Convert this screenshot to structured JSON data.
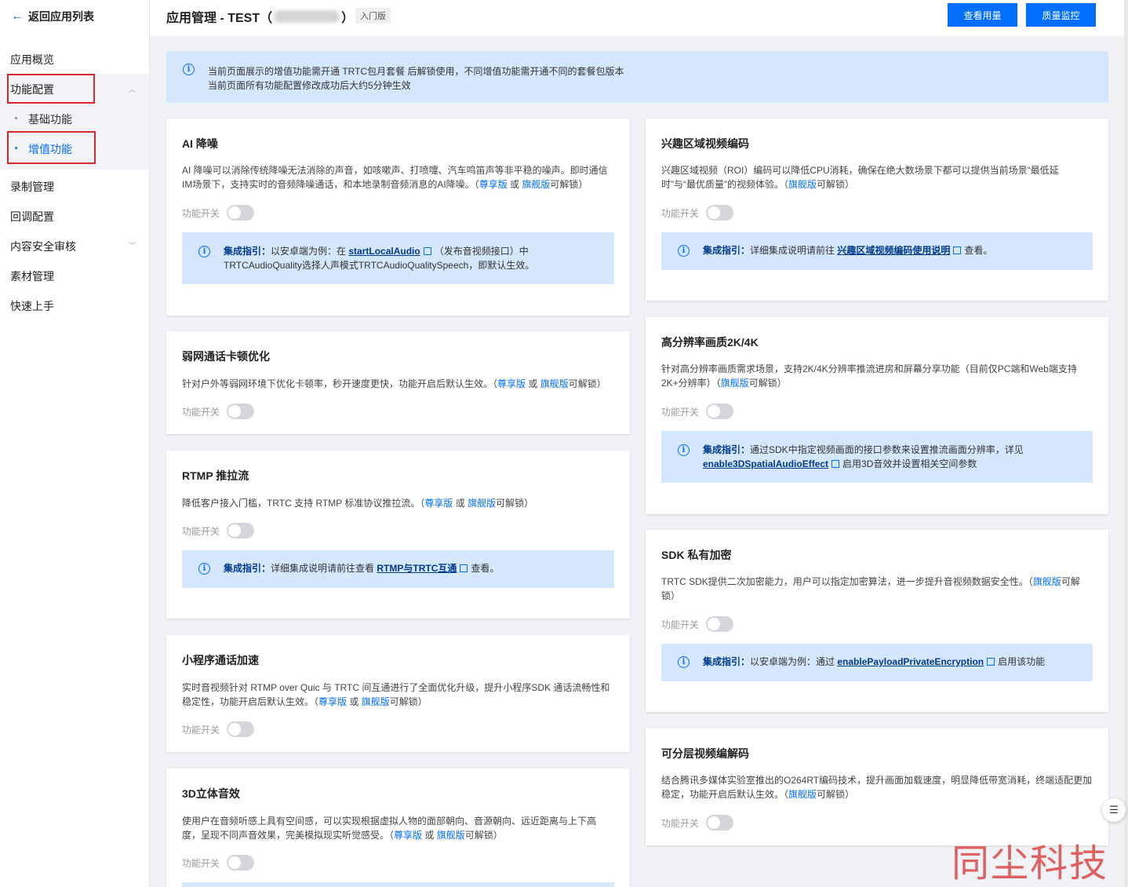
{
  "sidebar": {
    "back_label": "返回应用列表",
    "items": [
      "应用概览",
      "功能配置",
      "录制管理",
      "回调配置",
      "内容安全审核",
      "素材管理",
      "快速上手"
    ],
    "sub_items": [
      "基础功能",
      "增值功能"
    ]
  },
  "header": {
    "title_prefix": "应用管理 - TEST（",
    "title_suffix": "）",
    "edition_badge": "入门版",
    "btn_usage": "查看用量",
    "btn_monitor": "质量监控"
  },
  "notice": {
    "line1": "当前页面展示的增值功能需开通 TRTC包月套餐 后解锁使用，不同增值功能需开通不同的套餐包版本",
    "line2": "当前页面所有功能配置修改成功后大约5分钟生效"
  },
  "common": {
    "toggle_label": "功能开关",
    "guide_prefix": "集成指引：",
    "premium": "尊享版",
    "or": "或",
    "flagship": "旗舰版",
    "unlock": "可解锁",
    "paren_open": "（",
    "paren_close": "）"
  },
  "cards": {
    "ai_noise": {
      "title": "AI 降噪",
      "desc": "AI 降噪可以消除传统降噪无法消除的声音，如咳嗽声、打喷嚏、汽车鸣笛声等非平稳的噪声。即时通信IM场景下，支持实时的音频降噪通话，和本地录制音频消息的AI降噪。",
      "guide_a": "以安卓端为例：在",
      "guide_link": "startLocalAudio",
      "guide_b": "（发布音视频接口）中TRTCAudioQuality选择人声模式TRTCAudioQualitySpeech，即默认生效。"
    },
    "weak_net": {
      "title": "弱网通话卡顿优化",
      "desc": "针对户外等弱网环境下优化卡顿率，秒开速度更快，功能开启后默认生效。"
    },
    "rtmp": {
      "title": "RTMP 推拉流",
      "desc": "降低客户接入门槛，TRTC 支持 RTMP 标准协议推拉流。",
      "guide_a": "详细集成说明请前往查看",
      "guide_link": "RTMP与TRTC互通",
      "guide_b": "查看。"
    },
    "miniprogram": {
      "title": "小程序通话加速",
      "desc": "实时音视频针对 RTMP over Quic 与 TRTC 间互通进行了全面优化升级，提升小程序SDK 通话流畅性和稳定性，功能开启后默认生效。"
    },
    "spatial": {
      "title": "3D立体音效",
      "desc": "使用户在音频听感上具有空间感，可以实现根据虚拟人物的面部朝向、音源朝向、远近距离与上下高度，呈现不同声音效果，完美模拟现实听觉感受。"
    },
    "roi": {
      "title": "兴趣区域视频编码",
      "desc": "兴趣区域视频（ROI）编码可以降低CPU消耗，确保在绝大数场景下都可以提供当前场景“最低延时”与“最优质量”的视频体验。",
      "guide_a": "详细集成说明请前往",
      "guide_link": "兴趣区域视频编码使用说明",
      "guide_b": "查看。"
    },
    "hires": {
      "title": "高分辨率画质2K/4K",
      "desc": "针对高分辨率画质需求场景，支持2K/4K分辨率推流进房和屏幕分享功能（目前仅PC端和Web端支持2K+分辨率）",
      "guide_a": "通过SDK中指定视频画面的接口参数来设置推流画面分辨率，详见",
      "guide_link": "enable3DSpatialAudioEffect",
      "guide_b": "启用3D音效并设置相关空间参数"
    },
    "encrypt": {
      "title": "SDK 私有加密",
      "desc": "TRTC SDK提供二次加密能力，用户可以指定加密算法，进一步提升音视频数据安全性。",
      "guide_a": "以安卓端为例：通过",
      "guide_link": "enablePayloadPrivateEncryption",
      "guide_b": "启用该功能"
    },
    "svc": {
      "title": "可分层视频编解码",
      "desc": "结合腾讯多媒体实验室推出的O264RT编码技术，提升画面加载速度，明显降低带宽消耗，终端适配更加稳定，功能开启后默认生效。"
    }
  },
  "watermark": "同尘科技",
  "colors": {
    "accent": "#006eff",
    "highlight_box": "#e0242d",
    "info_bg": "#d5e7fd"
  }
}
